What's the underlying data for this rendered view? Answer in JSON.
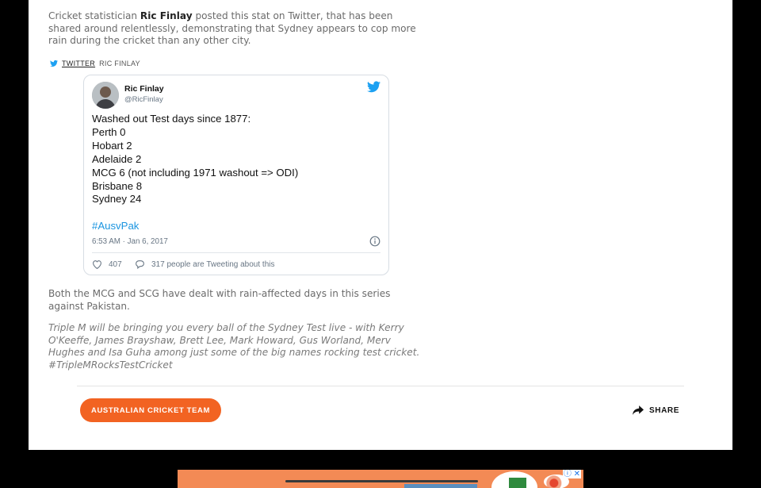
{
  "article": {
    "p1_pre": "Cricket statistician ",
    "p1_bold": "Ric Finlay",
    "p1_post": " posted this stat on Twitter, that has been shared around relentlessly, demonstrating that Sydney appears to cop more rain during the cricket than any other city.",
    "p2": "Both the MCG and SCG have dealt with rain-affected days in this series against Pakistan.",
    "p3": "Triple M will be bringing you every ball of the Sydney Test live - with Kerry O'Keeffe, James Brayshaw, Brett Lee, Mark Howard, Gus Worland, Merv Hughes and Isa Guha among just some of the big names rocking test cricket. #TripleMRocksTestCricket"
  },
  "embed_label": {
    "source": "TWITTER",
    "author": "RIC FINLAY"
  },
  "tweet": {
    "name": "Ric Finlay",
    "handle": "@RicFinlay",
    "lines": [
      "Washed out Test days since 1877:",
      "Perth 0",
      "Hobart 2",
      "Adelaide 2",
      "MCG 6 (not including 1971 washout => ODI)",
      "Brisbane 8",
      "Sydney 24"
    ],
    "hashtag": "#AusvPak",
    "time": "6:53 AM · Jan 6, 2017",
    "likes": "407",
    "replies": "317 people are Tweeting about this"
  },
  "footer": {
    "tag": "AUSTRALIAN CRICKET TEAM",
    "share": "SHARE"
  },
  "ad": {
    "close": "ⓘ ✕"
  },
  "colors": {
    "accent": "#f26322",
    "twitter_blue": "#1da1f2",
    "hashtag": "#1b95e0"
  }
}
